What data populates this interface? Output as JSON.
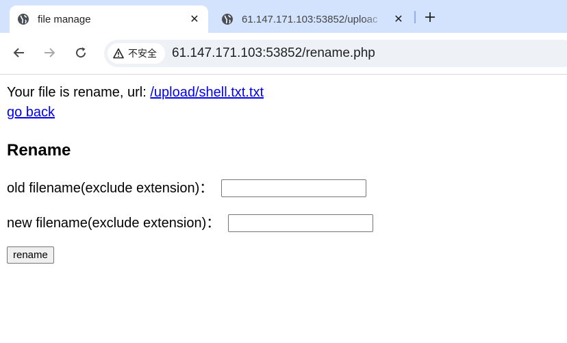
{
  "browser": {
    "tabs": [
      {
        "title": "file manage",
        "active": true,
        "favicon": "globe-icon"
      },
      {
        "title": "61.147.171.103:53852/uploac",
        "active": false,
        "favicon": "globe-icon"
      }
    ],
    "security_label": "不安全",
    "url": "61.147.171.103:53852/rename.php"
  },
  "page": {
    "message_prefix": "Your file is rename, url: ",
    "message_link": "/upload/shell.txt.txt",
    "back_link": "go back",
    "heading": "Rename",
    "old_label": "old filename(exclude extension)：",
    "old_value": "",
    "new_label": "new filename(exclude extension)：",
    "new_value": "",
    "submit_label": "rename"
  }
}
